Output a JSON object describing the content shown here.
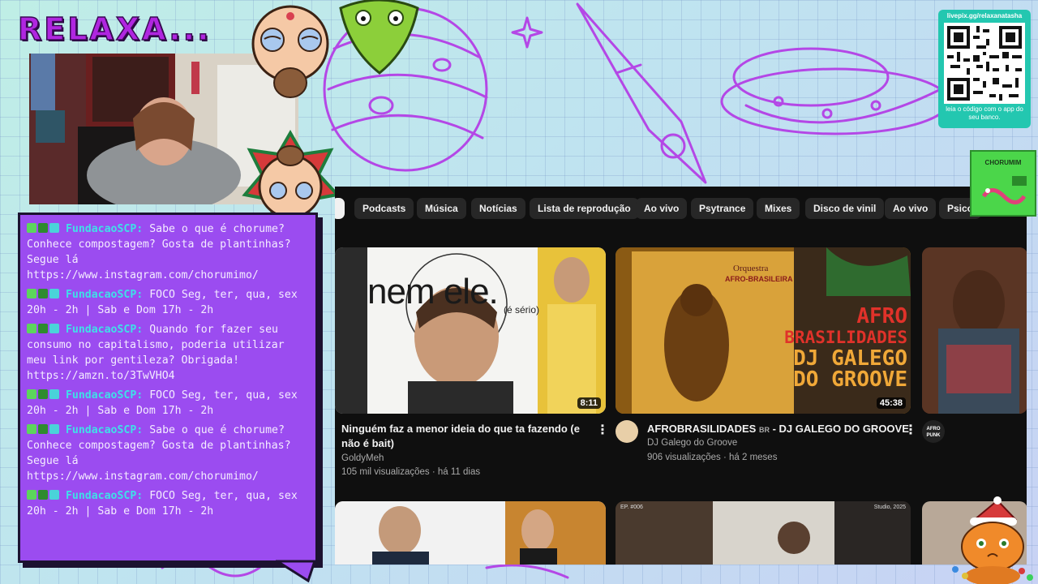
{
  "overlay": {
    "title": "RELAXA...",
    "colors": {
      "title": "#b026e0",
      "chat_bg": "#9b4cf0",
      "chat_user": "#3fe0e8",
      "qr_bg": "#23c7b0"
    }
  },
  "chat": {
    "messages": [
      {
        "user": "FundacaoSCP:",
        "text": "Sabe o que é chorume? Conhece compostagem? Gosta de plantinhas? Segue lá https://www.instagram.com/chorumimo/"
      },
      {
        "user": "FundacaoSCP:",
        "text": "FOCO Seg, ter, qua, sex 20h - 2h | Sab e Dom 17h - 2h"
      },
      {
        "user": "FundacaoSCP:",
        "text": "Quando for fazer seu consumo no capitalismo, poderia utilizar meu link por gentileza? Obrigada! https://amzn.to/3TwVHO4"
      },
      {
        "user": "FundacaoSCP:",
        "text": "FOCO Seg, ter, qua, sex 20h - 2h | Sab e Dom 17h - 2h"
      },
      {
        "user": "FundacaoSCP:",
        "text": "Sabe o que é chorume? Conhece compostagem? Gosta de plantinhas? Segue lá https://www.instagram.com/chorumimo/"
      },
      {
        "user": "FundacaoSCP:",
        "text": "FOCO Seg, ter, qua, sex 20h - 2h | Sab e Dom 17h - 2h"
      }
    ]
  },
  "youtube": {
    "chips": [
      "Podcasts",
      "Música",
      "Notícias",
      "Lista de reprodução",
      "Ao vivo",
      "Psytrance",
      "Mixes",
      "Disco de vinil",
      "Ao vivo",
      "Psico"
    ],
    "videos": [
      {
        "title_line1": "Ninguém faz a menor ideia do que ta fazendo (e",
        "title_line2": "não é bait)",
        "channel": "GoldyMeh",
        "stats": "105 mil visualizações · há 11 dias",
        "duration": "8:11",
        "thumb_text": "nem ele.",
        "thumb_subtext": "(é sério)"
      },
      {
        "title": "AFROBRASILIDADES",
        "title_suffix": "BR",
        "title_rest": "- DJ GALEGO DO GROOVE",
        "channel": "DJ Galego do Groove",
        "stats": "906 visualizações · há 2 meses",
        "duration": "45:38",
        "thumb_line1": "AFRO",
        "thumb_line2": "BRASILIDADES",
        "thumb_line3": "DJ GALEGO",
        "thumb_line4": "DO GROOVE",
        "thumb_small": "Orquestra",
        "thumb_small2": "AFRO-BRASILEIRA"
      },
      {
        "channel_avatar_text": "AFRO PUNK"
      }
    ],
    "row2_labels": {
      "ep": "EP. #006",
      "studio": "Studio, 2025"
    }
  },
  "qr": {
    "url": "livepix.gg/relaxanatasha",
    "caption": "leia o código com o app do seu banco."
  },
  "chorumim": {
    "label": "CHORUMIM"
  }
}
